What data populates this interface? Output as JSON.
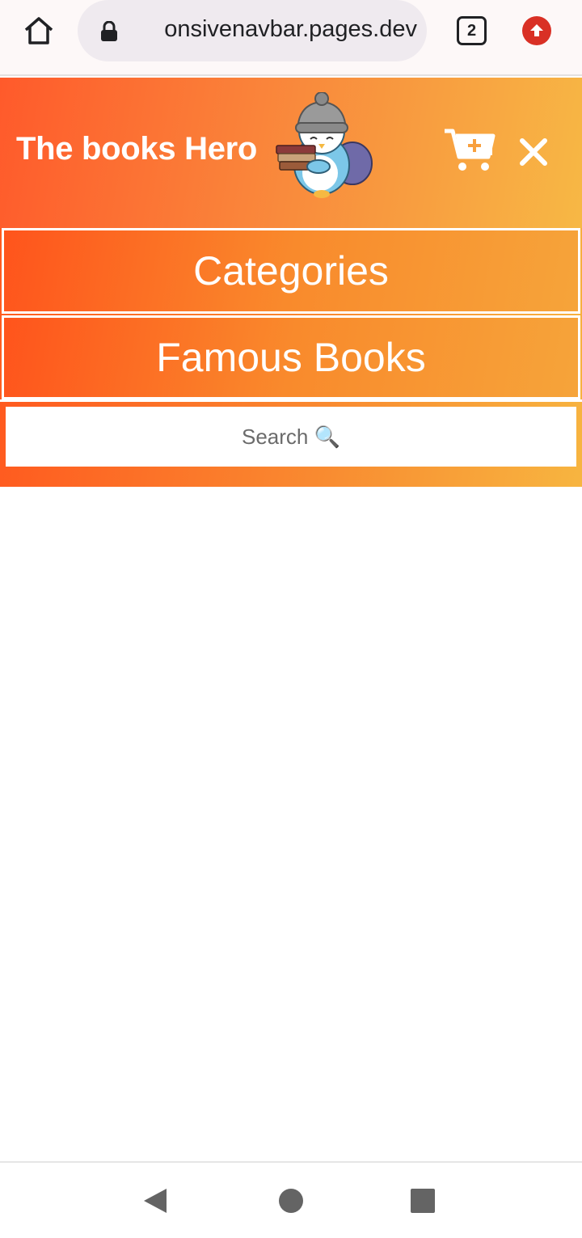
{
  "browser": {
    "url": "onsivenavbar.pages.dev",
    "tab_count": "2",
    "icons": [
      "home-icon",
      "lock-icon",
      "tabs-icon",
      "update-icon"
    ]
  },
  "header": {
    "brand": "The books Hero",
    "icons": [
      "penguin-mascot-icon",
      "cart-plus-icon",
      "close-icon"
    ]
  },
  "menu": {
    "items": [
      {
        "label": "Categories"
      },
      {
        "label": "Famous Books"
      }
    ],
    "search_placeholder": "Search 🔍"
  },
  "system_nav": {
    "icons": [
      "back-icon",
      "home-circle-icon",
      "recents-icon"
    ]
  },
  "colors": {
    "gradient_start": "#ff5a2b",
    "gradient_end": "#f7b845",
    "text_on_gradient": "#ffffff",
    "update_badge": "#d93025"
  }
}
